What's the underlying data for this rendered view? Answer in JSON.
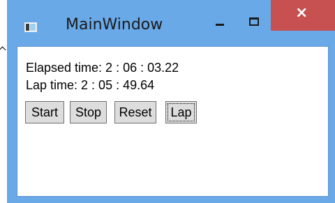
{
  "window": {
    "title": "MainWindow",
    "icons": {
      "app": "application-icon",
      "minimize": "minimize-icon",
      "maximize": "maximize-icon",
      "close": "close-icon"
    },
    "close_glyph": "×",
    "colors": {
      "frame": "#6aa9e8",
      "close_button": "#c75050",
      "client_background": "#ffffff",
      "button_background": "#dddddd",
      "button_border": "#707070"
    }
  },
  "stopwatch": {
    "elapsed_text": "Elapsed time: 2 : 06 : 03.22",
    "lap_text": "Lap time: 2 : 05 : 49.64"
  },
  "buttons": {
    "start": "Start",
    "stop": "Stop",
    "reset": "Reset",
    "lap": "Lap"
  }
}
